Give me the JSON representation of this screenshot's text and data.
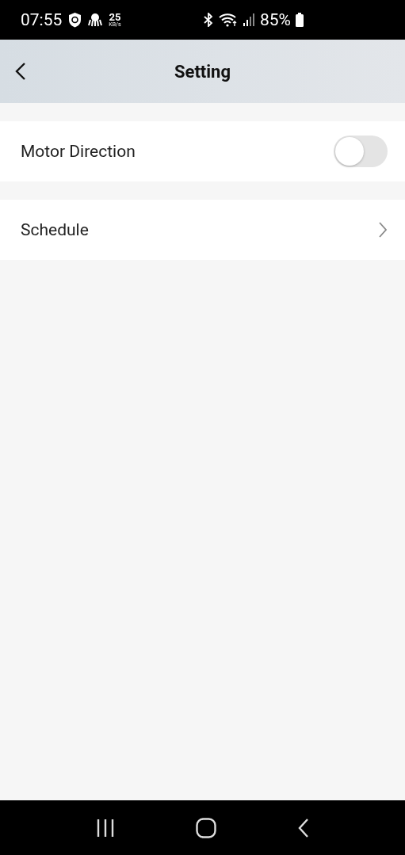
{
  "status_bar": {
    "time": "07:55",
    "speed_value": "25",
    "speed_unit": "KB/s",
    "battery": "85%"
  },
  "header": {
    "title": "Setting"
  },
  "rows": [
    {
      "kind": "toggle",
      "label": "Motor Direction",
      "on": false
    },
    {
      "kind": "link",
      "label": "Schedule"
    }
  ]
}
